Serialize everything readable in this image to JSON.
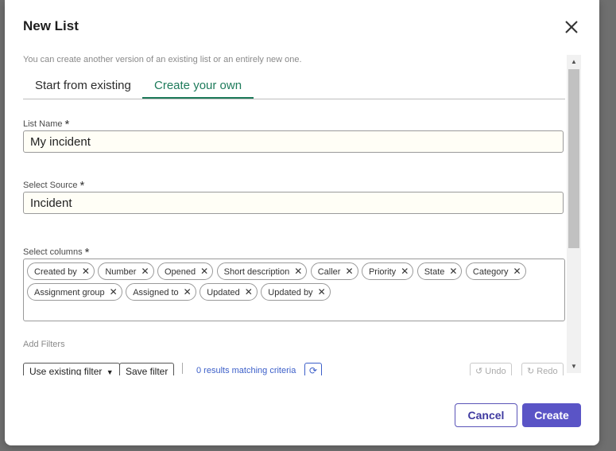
{
  "dialog": {
    "title": "New List",
    "hint": "You can create another version of an existing list or an entirely new one."
  },
  "tabs": [
    {
      "label": "Start from existing",
      "active": false
    },
    {
      "label": "Create your own",
      "active": true
    }
  ],
  "fields": {
    "list_name": {
      "label": "List Name",
      "required_mark": "*",
      "value": "My incident"
    },
    "source": {
      "label": "Select Source",
      "required_mark": "*",
      "value": "Incident"
    },
    "columns": {
      "label": "Select columns",
      "required_mark": "*"
    }
  },
  "columns": [
    "Created by",
    "Number",
    "Opened",
    "Short description",
    "Caller",
    "Priority",
    "State",
    "Category",
    "Assignment group",
    "Assigned to",
    "Updated",
    "Updated by"
  ],
  "filters": {
    "label": "Add Filters",
    "use_existing": "Use existing filter",
    "save": "Save filter",
    "results": "0 results matching criteria",
    "undo": "Undo",
    "redo": "Redo"
  },
  "footer": {
    "cancel": "Cancel",
    "create": "Create"
  },
  "icons": {
    "close": "close-icon",
    "remove_chip": "close-icon",
    "refresh": "refresh-icon",
    "dropdown": "caret-down-icon"
  },
  "colors": {
    "accent": "#5a54c6",
    "active_tab": "#1e7b5b",
    "link": "#3c5fc9",
    "field_background": "#fffef6"
  }
}
